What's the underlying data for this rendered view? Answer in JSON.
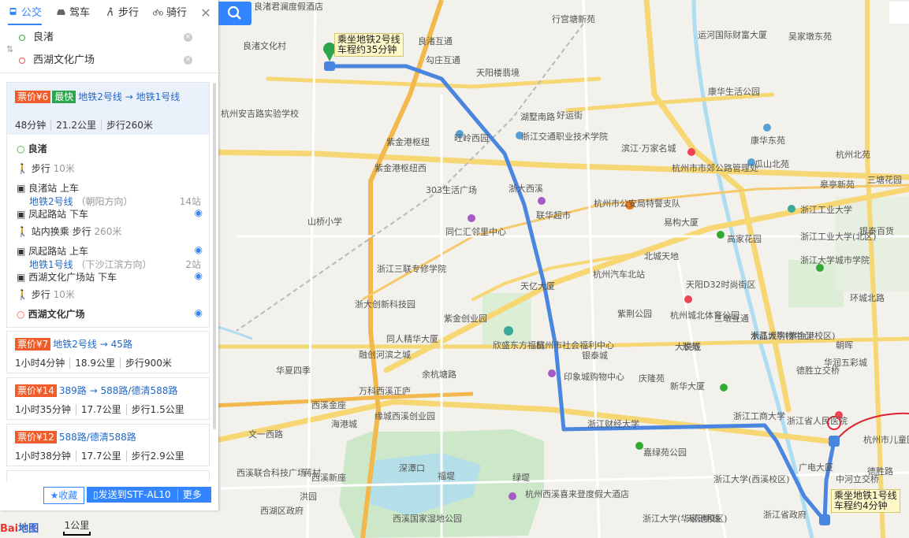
{
  "modes": [
    {
      "label": "公交",
      "icon": "bus-icon",
      "active": true
    },
    {
      "label": "驾车",
      "icon": "car-icon",
      "active": false
    },
    {
      "label": "步行",
      "icon": "walk-icon",
      "active": false
    },
    {
      "label": "骑行",
      "icon": "bike-icon",
      "active": false
    }
  ],
  "search": {
    "origin": "良渚",
    "destination": "西湖文化广场"
  },
  "results": [
    {
      "fare": "票价¥6",
      "tag": "最快",
      "route": "地铁2号线 → 地铁1号线",
      "duration": "48分钟",
      "distance": "21.2公里",
      "walk": "步行260米",
      "steps": {
        "start": "良渚",
        "walk1": "步行",
        "walk1_dist": "10米",
        "board1": "良渚站 上车",
        "line1": "地铁2号线",
        "dir1": "（朝阳方向）",
        "stops1": "14站",
        "alight1": "凤起路站 下车",
        "transfer": "站内换乘 步行",
        "transfer_dist": "260米",
        "board2": "凤起路站 上车",
        "line2": "地铁1号线",
        "dir2": "（下沙江滨方向）",
        "stops2": "2站",
        "alight2": "西湖文化广场站 下车",
        "walk2": "步行",
        "walk2_dist": "10米",
        "end": "西湖文化广场"
      }
    },
    {
      "fare": "票价¥7",
      "route": "地铁2号线 → 45路",
      "duration": "1小时4分钟",
      "distance": "18.9公里",
      "walk": "步行900米"
    },
    {
      "fare": "票价¥14",
      "route": "389路 → 588路/德清588路",
      "duration": "1小时35分钟",
      "distance": "17.7公里",
      "walk": "步行1.5公里"
    },
    {
      "fare": "票价¥12",
      "route": "588路/德清588路",
      "duration": "1小时38分钟",
      "distance": "17.7公里",
      "walk": "步行2.9公里"
    }
  ],
  "actions": {
    "favorite": "收藏",
    "send": "发送到STF-AL10",
    "more": "更多"
  },
  "map": {
    "bubble_start": [
      "乘坐地铁2号线",
      "车程约35分钟"
    ],
    "bubble_end": [
      "乘坐地铁1号线",
      "车程约4分钟"
    ],
    "scale": "1公里",
    "labels": [
      "良渚君澜度假酒店",
      "良渚文化村",
      "良渚互通",
      "勾庄互通",
      "天阳楼翡境",
      "行宫塘新苑",
      "运河国际财富大厦",
      "吴家墩东苑",
      "杭州安吉路实验学校",
      "好运街",
      "旺岭西园",
      "浙江交通职业技术学院",
      "滨江·万家名城",
      "康华生活公园",
      "康华东苑",
      "杭州北苑",
      "紫金港枢纽",
      "紫金港枢纽西",
      "303生活广场",
      "浙大西溪",
      "杭州市市郊公路管理处",
      "瓜山北苑",
      "皋亭新苑",
      "三塘花园",
      "山桥小学",
      "同仁汇邻里中心",
      "联华超市",
      "杭州市公安局特警支队",
      "易构大厦",
      "浙江工业大学",
      "浙江三联专修学院",
      "天亿大厦",
      "杭州汽车北站",
      "北城天地",
      "高家花园",
      "天阳D32时尚街区",
      "浙江工业大学(北区)",
      "浙江大学城市学院",
      "银泰百货",
      "浙大创新科技园",
      "紫金创业园",
      "欣盛东方福邸",
      "杭州市社会福利中心",
      "紫荆公园",
      "杭州城北体育公园",
      "三墩互通",
      "浙江大学(紫金港校区)",
      "同人精华大厦",
      "银泰城",
      "大悦城",
      "水晶城购物中心",
      "华润五彩城",
      "融创河滨之城",
      "华夏四季",
      "余杭塘路",
      "万科西溪正庐",
      "印象城购物中心",
      "庆隆苑",
      "新华大厦",
      "德胜立交桥",
      "西溪金座",
      "缘城西溪创业园",
      "浙江工商大学",
      "海港城",
      "浙江财经大学",
      "嘉绿苑公园",
      "浙江省人民医院",
      "杭州市儿童医院",
      "西溪新座",
      "西溪国家湿地公园",
      "杭州西溪喜来登度假大酒店",
      "浙江大学(西溪校区)",
      "广电大厦",
      "浙江省政府",
      "中河立交桥",
      "深潭口",
      "福堤",
      "绿堤",
      "浙江大学(华家池校区)",
      "天阳明珠",
      "文一西路",
      "蒋村",
      "西溪联合科技广场",
      "洪园",
      "西湖区政府",
      "翠苑",
      "德胜路",
      "环城北路",
      "朝晖",
      "湖墅南路"
    ]
  }
}
